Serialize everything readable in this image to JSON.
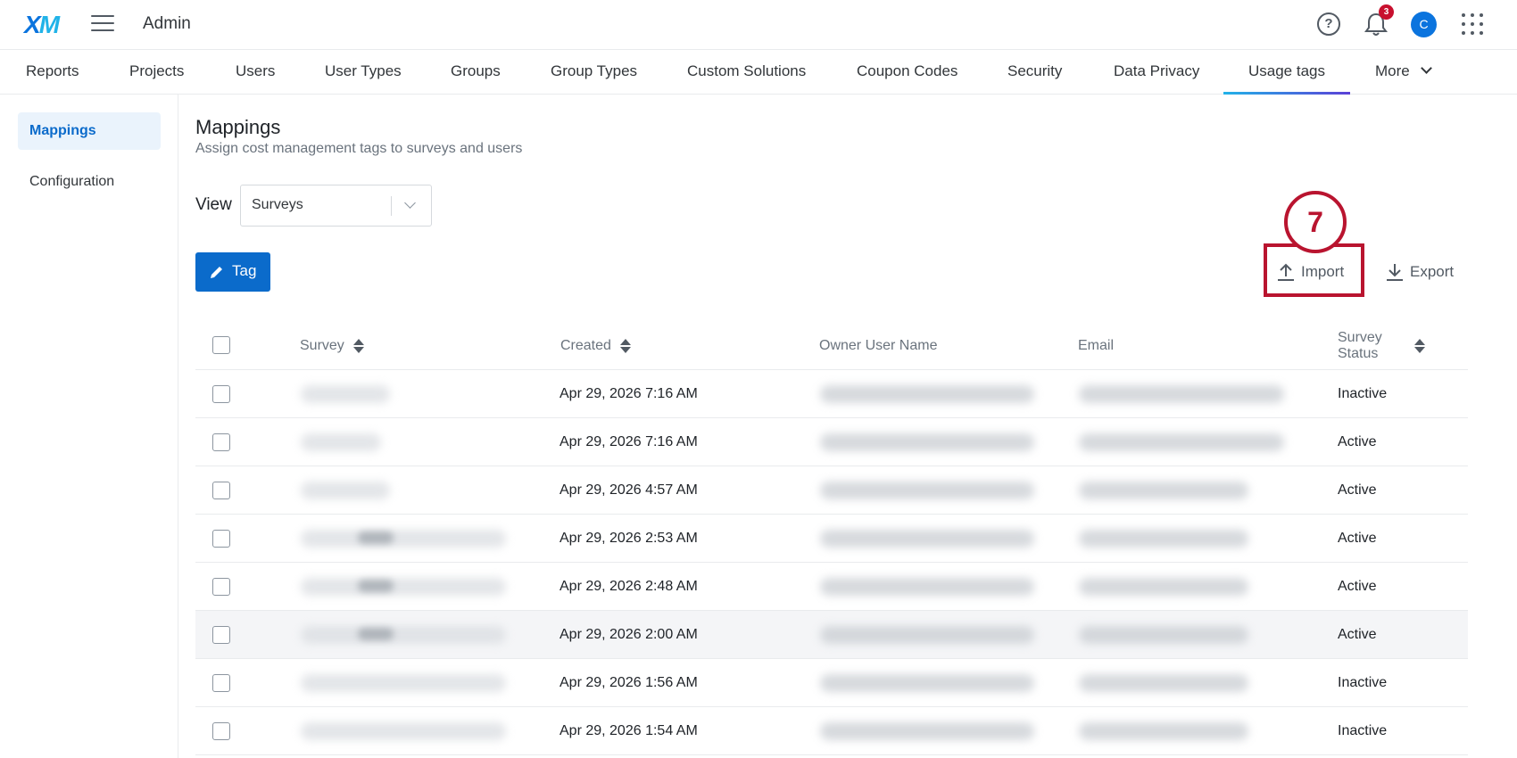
{
  "header": {
    "logo": "XM",
    "app_title": "Admin",
    "help_icon": "?",
    "notification_count": "3",
    "avatar_initial": "C"
  },
  "nav": {
    "tabs": [
      {
        "label": "Reports"
      },
      {
        "label": "Projects"
      },
      {
        "label": "Users"
      },
      {
        "label": "User Types"
      },
      {
        "label": "Groups"
      },
      {
        "label": "Group Types"
      },
      {
        "label": "Custom Solutions"
      },
      {
        "label": "Coupon Codes"
      },
      {
        "label": "Security"
      },
      {
        "label": "Data Privacy"
      },
      {
        "label": "Usage tags"
      },
      {
        "label": "More"
      }
    ],
    "active_tab": "Usage tags"
  },
  "sidebar": {
    "items": [
      {
        "label": "Mappings",
        "active": true
      },
      {
        "label": "Configuration",
        "active": false
      }
    ]
  },
  "main": {
    "title": "Mappings",
    "subtitle": "Assign cost management tags to surveys and users",
    "view_label": "View",
    "view_value": "Surveys",
    "tag_button": "Tag",
    "import_button": "Import",
    "export_button": "Export",
    "callout_number": "7"
  },
  "table": {
    "columns": {
      "survey": "Survey",
      "created": "Created",
      "owner": "Owner User Name",
      "email": "Email",
      "status_line1": "Survey",
      "status_line2": "Status"
    },
    "rows": [
      {
        "created": "Apr 29, 2026 7:16 AM",
        "status": "Inactive"
      },
      {
        "created": "Apr 29, 2026 7:16 AM",
        "status": "Active"
      },
      {
        "created": "Apr 29, 2026 4:57 AM",
        "status": "Active"
      },
      {
        "created": "Apr 29, 2026 2:53 AM",
        "status": "Active"
      },
      {
        "created": "Apr 29, 2026 2:48 AM",
        "status": "Active"
      },
      {
        "created": "Apr 29, 2026 2:00 AM",
        "status": "Active"
      },
      {
        "created": "Apr 29, 2026 1:56 AM",
        "status": "Inactive"
      },
      {
        "created": "Apr 29, 2026 1:54 AM",
        "status": "Inactive"
      }
    ]
  },
  "colors": {
    "accent": "#0b6bcb",
    "callout": "#b9142f",
    "badge": "#c8102e"
  }
}
